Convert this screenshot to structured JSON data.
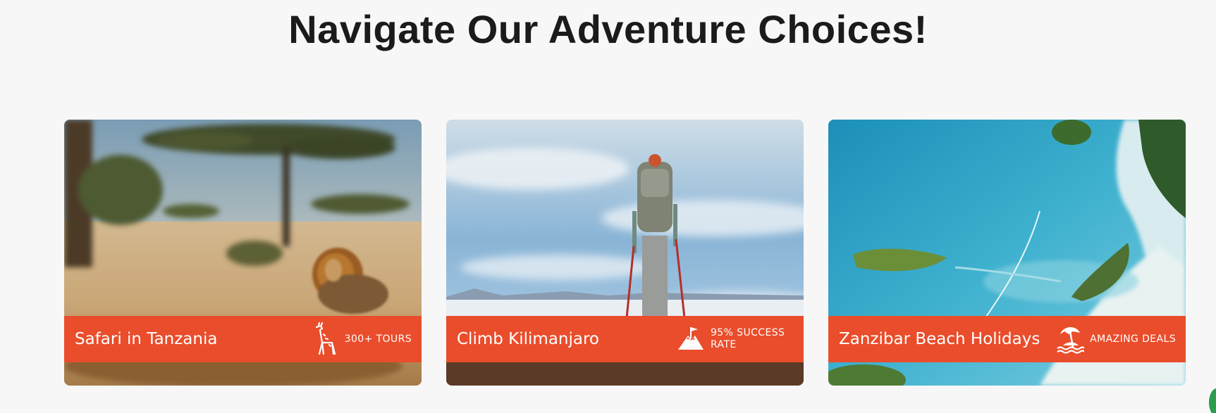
{
  "section": {
    "heading": "Navigate Our Adventure Choices!"
  },
  "cards": [
    {
      "title": "Safari in Tanzania",
      "badge_icon": "giraffe-icon",
      "badge_text": "300+ TOURS"
    },
    {
      "title": "Climb Kilimanjaro",
      "badge_icon": "mountain-flag-icon",
      "badge_text": "95% SUCCESS RATE"
    },
    {
      "title": "Zanzibar Beach Holidays",
      "badge_icon": "beach-umbrella-icon",
      "badge_text": "AMAZING DEALS"
    }
  ],
  "colors": {
    "accent": "#ea4d2b",
    "background": "#f7f7f7",
    "heading": "#1b1b1b"
  }
}
